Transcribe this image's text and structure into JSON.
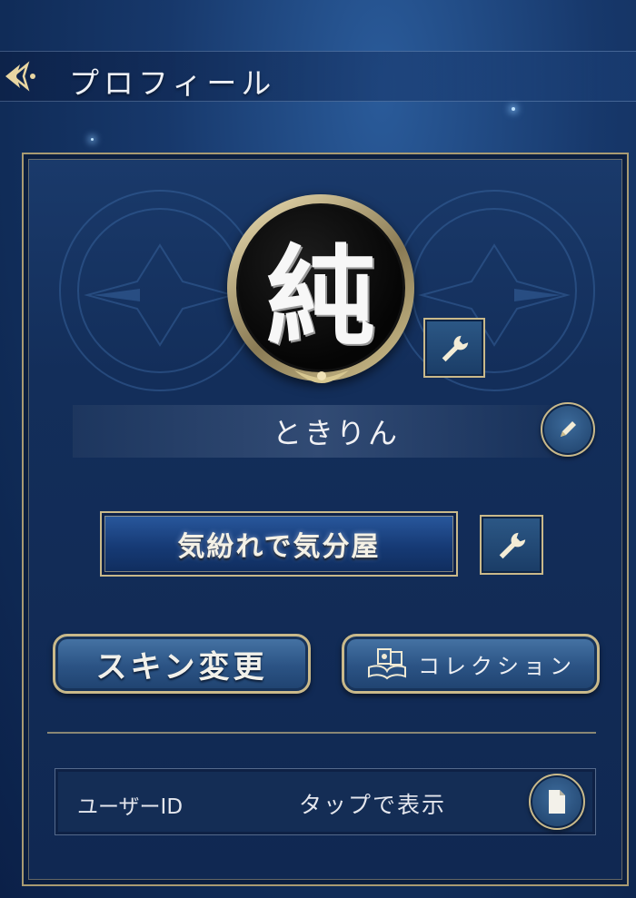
{
  "header": {
    "title": "プロフィール"
  },
  "profile": {
    "avatar_glyph": "純",
    "name": "ときりん",
    "title_text": "気紛れで気分屋"
  },
  "buttons": {
    "skin_change": "スキン変更",
    "collection": "コレクション"
  },
  "user_id": {
    "label": "ユーザーID",
    "value": "タップで表示"
  },
  "icons": {
    "back": "back-arrow-icon",
    "wrench": "wrench-icon",
    "pencil": "pencil-icon",
    "collection_book": "book-icon",
    "copy_document": "document-icon"
  },
  "colors": {
    "gold_border": "#c9b98a",
    "panel_blue": "#132e5a",
    "background_blue": "#17386b"
  }
}
